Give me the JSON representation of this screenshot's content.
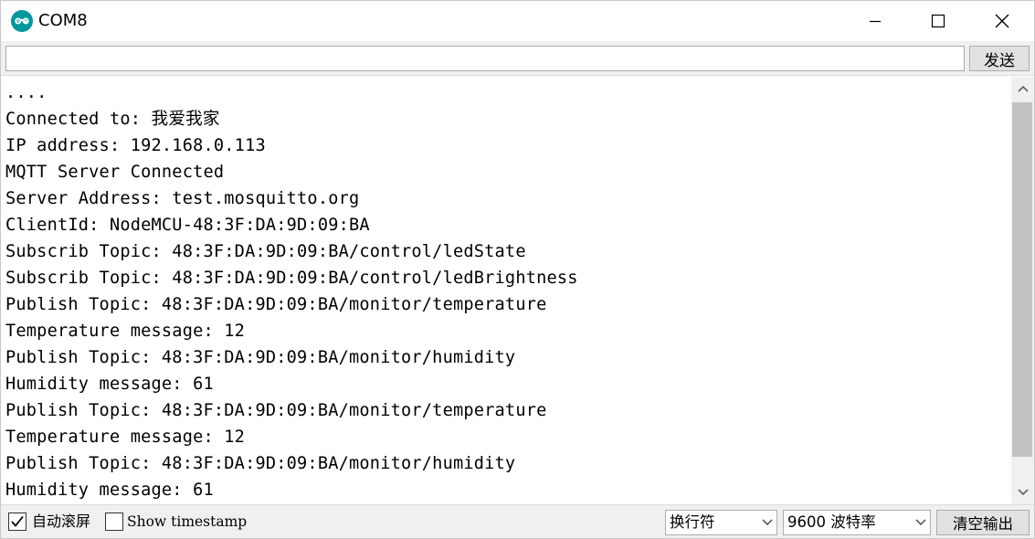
{
  "window": {
    "title": "COM8",
    "brand_color": "#00979d"
  },
  "send_bar": {
    "input_value": "",
    "send_label": "发送"
  },
  "output": {
    "lines": [
      "....",
      "Connected to: 我爱我家",
      "IP address: 192.168.0.113",
      "MQTT Server Connected",
      "Server Address: test.mosquitto.org",
      "ClientId: NodeMCU-48:3F:DA:9D:09:BA",
      "Subscrib Topic: 48:3F:DA:9D:09:BA/control/ledState",
      "Subscrib Topic: 48:3F:DA:9D:09:BA/control/ledBrightness",
      "Publish Topic: 48:3F:DA:9D:09:BA/monitor/temperature",
      "Temperature message: 12",
      "Publish Topic: 48:3F:DA:9D:09:BA/monitor/humidity",
      "Humidity message: 61",
      "Publish Topic: 48:3F:DA:9D:09:BA/monitor/temperature",
      "Temperature message: 12",
      "Publish Topic: 48:3F:DA:9D:09:BA/monitor/humidity",
      "Humidity message: 61"
    ]
  },
  "status_bar": {
    "autoscroll_label": "自动滚屏",
    "autoscroll_checked": true,
    "timestamp_label": "Show timestamp",
    "timestamp_checked": false,
    "line_ending_value": "换行符",
    "baud_value": "9600 波特率",
    "clear_label": "清空输出"
  },
  "icons": {
    "app": "arduino-logo-icon",
    "minimize": "minimize-icon",
    "maximize": "maximize-icon",
    "close": "close-icon",
    "scroll_up": "chevron-up-icon",
    "scroll_down": "chevron-down-icon",
    "select_arrow": "chevron-down-icon",
    "check": "checkmark-icon"
  }
}
